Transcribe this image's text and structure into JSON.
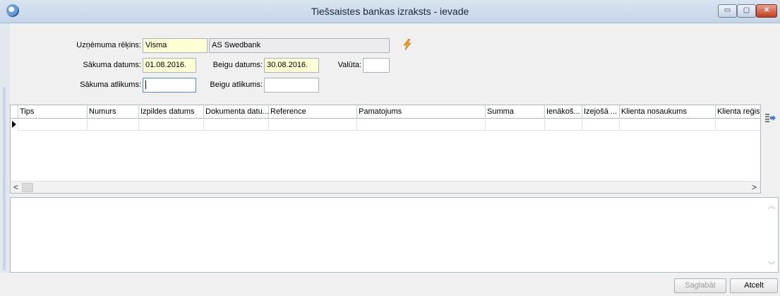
{
  "window": {
    "title": "Tiešsaistes bankas izraksts - ievade",
    "min_glyph": "▭",
    "max_glyph": "▢",
    "close_glyph": "✕"
  },
  "form": {
    "account_label": "Uzņēmuma rēķins:",
    "account_value": "Visma",
    "bank_name": "AS Swedbank",
    "start_date_label": "Sākuma datums:",
    "start_date_value": "01.08.2016.",
    "end_date_label": "Beigu datums:",
    "end_date_value": "30.08.2016.",
    "currency_label": "Valūta:",
    "currency_value": "",
    "start_balance_label": "Sākuma atlikums:",
    "start_balance_value": "",
    "end_balance_label": "Beigu atlikums:",
    "end_balance_value": ""
  },
  "grid": {
    "columns": [
      "Tips",
      "Numurs",
      "Izpildes datums",
      "Dokumenta datu...",
      "Reference",
      "Pamatojums",
      "Summa",
      "Ienākoš...",
      "Izejošā ...",
      "Klienta nosaukums",
      "Klienta reģist"
    ],
    "scroll_left": "<",
    "scroll_right": ">"
  },
  "buttons": {
    "save": "Saglabāt",
    "cancel": "Atcelt"
  },
  "icons": {
    "app": "app-globe-icon",
    "action": "lightning-bolt-icon",
    "column_chooser": "column-chooser-icon"
  },
  "colors": {
    "highlight_field": "#ffffd6",
    "title_bar": "#d9e4f1",
    "close_button": "#c23d20",
    "bolt": "#f0a020"
  }
}
